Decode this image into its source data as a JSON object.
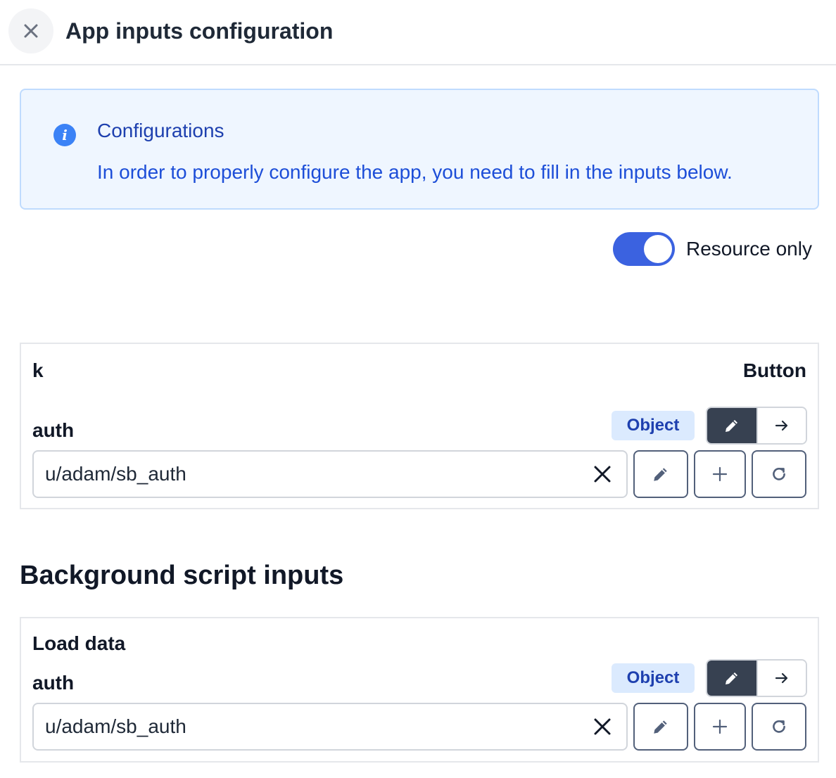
{
  "header": {
    "title": "App inputs configuration",
    "close_icon": "close-icon"
  },
  "alert": {
    "icon": "info-icon",
    "icon_glyph": "i",
    "title": "Configurations",
    "message": "In order to properly configure the app, you need to fill in the inputs below."
  },
  "toggle": {
    "label": "Resource only",
    "checked": true,
    "accent": "#3b62e0"
  },
  "components": [
    {
      "id": "k",
      "type": "Button",
      "field": {
        "name": "auth",
        "type_badge": "Object",
        "value": "u/adam/sb_auth"
      }
    }
  ],
  "background_section": {
    "title": "Background script inputs",
    "scripts": [
      {
        "name": "Load data",
        "field": {
          "name": "auth",
          "type_badge": "Object",
          "value": "u/adam/sb_auth"
        }
      }
    ]
  },
  "icons": {
    "edit": "pencil-icon",
    "connect": "arrow-right-icon",
    "clear": "x-icon",
    "add": "plus-icon",
    "refresh": "refresh-icon"
  }
}
